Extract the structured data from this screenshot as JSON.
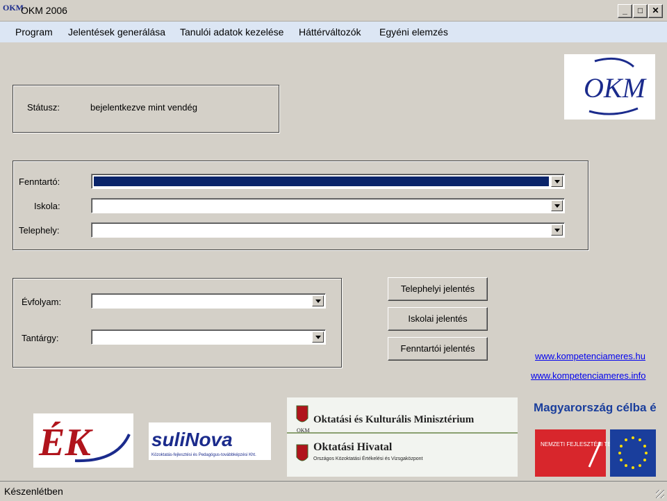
{
  "window": {
    "title": "OKM 2006",
    "icon": "okm-app-icon",
    "controls": [
      "minimize-icon",
      "maximize-icon",
      "close-icon"
    ]
  },
  "menu": {
    "items": [
      "Program",
      "Jelentések generálása",
      "Tanulói adatok kezelése",
      "Háttérváltozók",
      "Egyéni elemzés"
    ]
  },
  "status_group": {
    "label": "Státusz:",
    "value": "bejelentkezve mint vendég"
  },
  "selection_group": {
    "fenntarto_label": "Fenntartó:",
    "iskola_label": "Iskola:",
    "telephely_label": "Telephely:"
  },
  "filter_group": {
    "evfolyam_label": "Évfolyam:",
    "tantargy_label": "Tantárgy:"
  },
  "buttons": {
    "telephelyi": "Telephelyi jelentés",
    "iskolai": "Iskolai jelentés",
    "fenntartoi": "Fenntartói jelentés"
  },
  "links": [
    "www.kompetenciameres.hu",
    "www.kompetenciameres.info"
  ],
  "logos": {
    "okm": "OKM",
    "ek": "ÉK",
    "sulinova": "suliNova",
    "sulinova_sub": "Közoktatás-fejlesztési és Pedagógus-továbbképzési Kht.",
    "ministry": "Oktatási és Kulturális Minisztérium",
    "ministry_abbr": "OKM",
    "hivatal": "Oktatási Hivatal",
    "hivatal_sub": "Országos Közoktatási Értékelési és Vizsgaközpont",
    "magyarorszag": "Magyarország célba ér",
    "nft": "NEMZETI FEJLESZTÉSI TERV"
  },
  "statusbar": {
    "text": "Készenlétben"
  },
  "colors": {
    "menubar": "#dce6f4",
    "selection": "#0a246a",
    "link": "#0000ee",
    "okm_logo": "#1b2b8c",
    "nft_red": "#d8262c",
    "eu_blue": "#1a3e9c"
  }
}
